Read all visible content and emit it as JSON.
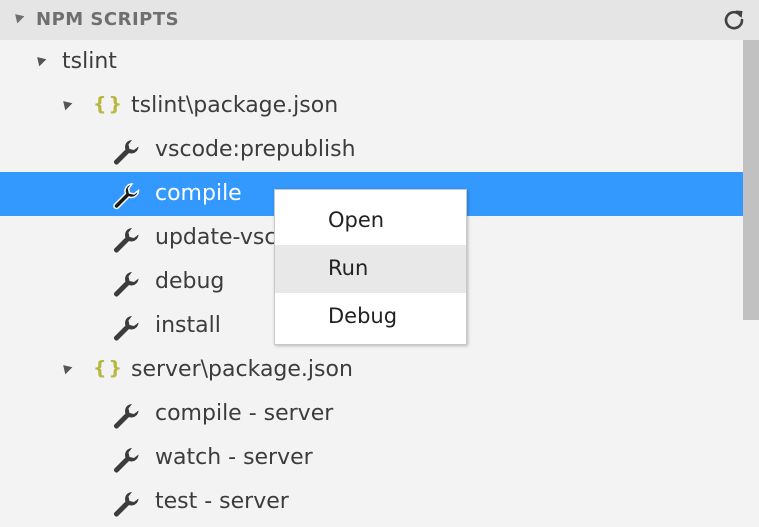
{
  "header": {
    "title": "NPM SCRIPTS",
    "refresh_icon": "refresh-icon"
  },
  "tree": {
    "root": {
      "label": "tslint",
      "expanded": true
    },
    "packages": [
      {
        "label": "tslint\\package.json",
        "expanded": true,
        "scripts": [
          "vscode:prepublish",
          "compile",
          "update-vsc",
          "debug",
          "install"
        ],
        "selected_script": "compile"
      },
      {
        "label": "server\\package.json",
        "expanded": true,
        "scripts": [
          "compile - server",
          "watch - server",
          "test - server"
        ]
      }
    ]
  },
  "context_menu": {
    "items": [
      "Open",
      "Run",
      "Debug"
    ],
    "highlighted": "Run"
  },
  "colors": {
    "selection": "#3399ff",
    "braces": "#b8b840",
    "header_bg": "#e5e5e5"
  }
}
